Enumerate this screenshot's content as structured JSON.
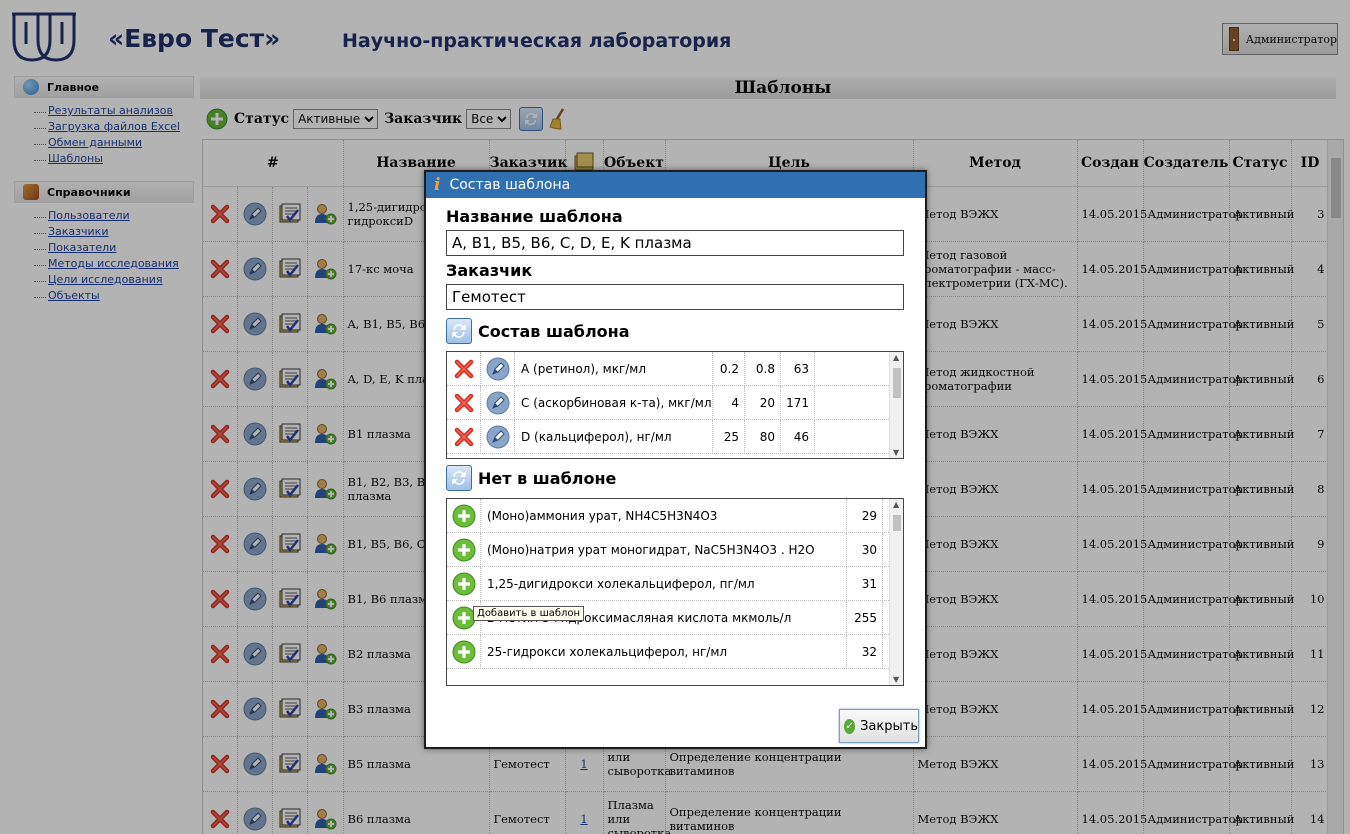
{
  "header": {
    "brand": "«Евро Тест»",
    "subtitle": "Научно-практическая лаборатория",
    "user_button": "Администратор"
  },
  "sidebar": {
    "sections": [
      {
        "title": "Главное",
        "icon": "globe-icon",
        "items": [
          "Результаты анализов",
          "Загрузка файлов Excel",
          "Обмен данными",
          "Шаблоны"
        ]
      },
      {
        "title": "Справочники",
        "icon": "tools-icon",
        "items": [
          "Пользователи",
          "Заказчики",
          "Показатели",
          "Методы исследования",
          "Цели исследования",
          "Объекты"
        ]
      }
    ]
  },
  "page": {
    "title": "Шаблоны",
    "filters": {
      "status_label": "Статус",
      "status_value": "Активные",
      "customer_label": "Заказчик",
      "customer_value": "Все"
    }
  },
  "grid": {
    "columns": [
      "#",
      "Название",
      "Заказчик",
      "",
      "Объект",
      "Цель",
      "Метод",
      "Создан",
      "Создатель",
      "Статус",
      "ID"
    ],
    "rows": [
      {
        "name": "1,25-дигидрокси гидроксиD",
        "customer": "",
        "link": "",
        "object": "",
        "goal": "",
        "method": "Метод ВЭЖХ",
        "created": "14.05.2015",
        "creator": "Администратор",
        "status": "Активный",
        "id": "3"
      },
      {
        "name": "17-кс моча",
        "customer": "",
        "link": "",
        "object": "",
        "goal": "",
        "method": "Метод газовой хроматографии - масс-спектрометрии (ГХ-МС).",
        "created": "14.05.2015",
        "creator": "Администратор",
        "status": "Активный",
        "id": "4"
      },
      {
        "name": "A, B1, B5, B6, плазма",
        "customer": "",
        "link": "",
        "object": "",
        "goal": "",
        "method": "Метод ВЭЖХ",
        "created": "14.05.2015",
        "creator": "Администратор",
        "status": "Активный",
        "id": "5"
      },
      {
        "name": "A, D, E, K плаз",
        "customer": "",
        "link": "",
        "object": "",
        "goal": "",
        "method": "Метод жидкостной хроматографии",
        "created": "14.05.2015",
        "creator": "Администратор",
        "status": "Активный",
        "id": "6"
      },
      {
        "name": "B1 плазма",
        "customer": "",
        "link": "",
        "object": "",
        "goal": "",
        "method": "Метод ВЭЖХ",
        "created": "14.05.2015",
        "creator": "Администратор",
        "status": "Активный",
        "id": "7"
      },
      {
        "name": "B1, B2, B3, B5, B12 плазма",
        "customer": "",
        "link": "",
        "object": "",
        "goal": "",
        "method": "Метод ВЭЖХ",
        "created": "14.05.2015",
        "creator": "Администратор",
        "status": "Активный",
        "id": "8"
      },
      {
        "name": "B1, B5, B6, C пл",
        "customer": "",
        "link": "",
        "object": "",
        "goal": "",
        "method": "Метод ВЭЖХ",
        "created": "14.05.2015",
        "creator": "Администратор",
        "status": "Активный",
        "id": "9"
      },
      {
        "name": "B1, B6 плазма",
        "customer": "",
        "link": "",
        "object": "",
        "goal": "",
        "method": "Метод ВЭЖХ",
        "created": "14.05.2015",
        "creator": "Администратор",
        "status": "Активный",
        "id": "10"
      },
      {
        "name": "B2 плазма",
        "customer": "",
        "link": "",
        "object": "",
        "goal": "",
        "method": "Метод ВЭЖХ",
        "created": "14.05.2015",
        "creator": "Администратор",
        "status": "Активный",
        "id": "11"
      },
      {
        "name": "B3 плазма",
        "customer": "",
        "link": "",
        "object": "",
        "goal": "",
        "method": "Метод ВЭЖХ",
        "created": "14.05.2015",
        "creator": "Администратор",
        "status": "Активный",
        "id": "12"
      },
      {
        "name": "B5 плазма",
        "customer": "Гемотест",
        "link": "1",
        "object": "или сыворотка",
        "goal": "Определение концентрации витаминов",
        "method": "Метод ВЭЖХ",
        "created": "14.05.2015",
        "creator": "Администратор",
        "status": "Активный",
        "id": "13"
      },
      {
        "name": "B6 плазма",
        "customer": "Гемотест",
        "link": "1",
        "object": "Плазма или сыворотка",
        "goal": "Определение концентрации витаминов",
        "method": "Метод ВЭЖХ",
        "created": "14.05.2015",
        "creator": "Администратор",
        "status": "Активный",
        "id": "14"
      }
    ]
  },
  "dialog": {
    "title": "Состав шаблона",
    "name_label": "Название шаблона",
    "name_value": "A, B1, B5, B6, C, D, E, K плазма",
    "customer_label": "Заказчик",
    "customer_value": "Гемотест",
    "composition_heading": "Состав шаблона",
    "composition": [
      {
        "name": "A (ретинол), мкг/мл",
        "v1": "0.2",
        "v2": "0.8",
        "id": "63"
      },
      {
        "name": "C (аскорбиновая к-та), мкг/мл",
        "v1": "4",
        "v2": "20",
        "id": "171"
      },
      {
        "name": "D (кальциферол), нг/мл",
        "v1": "25",
        "v2": "80",
        "id": "46"
      }
    ],
    "missing_heading": "Нет в шаблоне",
    "missing": [
      {
        "name": "(Моно)аммония урат, NH4C5H3N4O3",
        "id": "29"
      },
      {
        "name": "(Моно)натрия урат моногидрат, NaC5H3N4O3 . H2O",
        "id": "30"
      },
      {
        "name": "1,25-дигидрокси холекальциферол, пг/мл",
        "id": "31"
      },
      {
        "name": "2-метил-3-гидроксимасляная кислота мкмоль/л",
        "id": "255"
      },
      {
        "name": "25-гидрокси холекальциферол, нг/мл",
        "id": "32"
      }
    ],
    "tooltip": "Добавить в шаблон",
    "close_label": "Закрыть"
  }
}
